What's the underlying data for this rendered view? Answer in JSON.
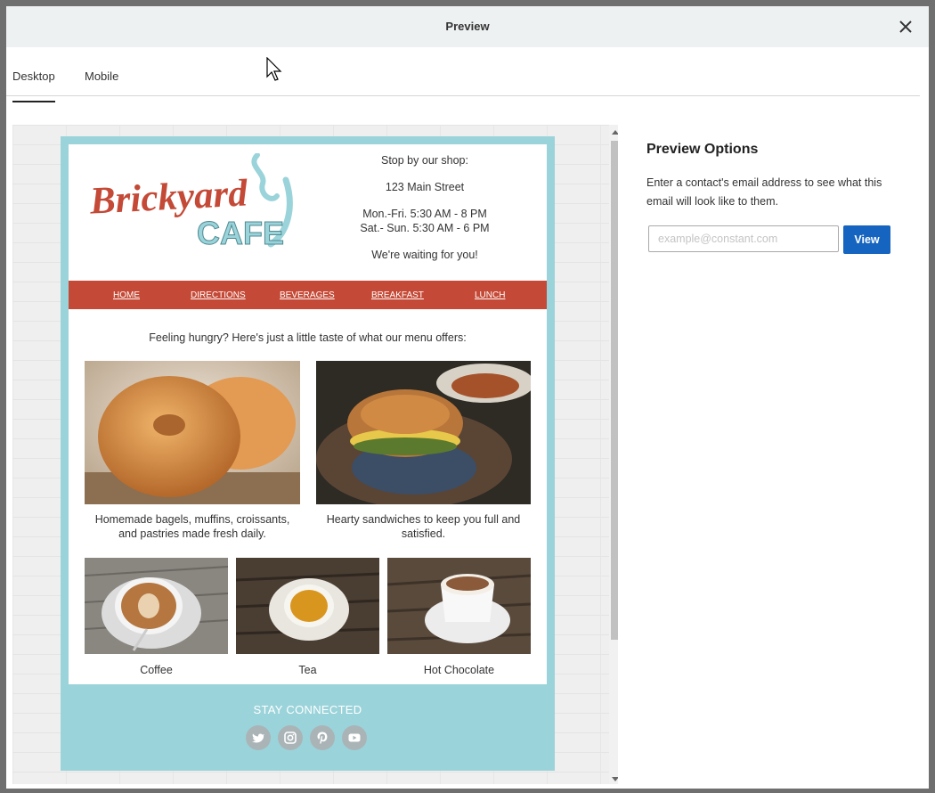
{
  "modal": {
    "title": "Preview"
  },
  "tabs": [
    {
      "label": "Desktop",
      "active": true
    },
    {
      "label": "Mobile",
      "active": false
    }
  ],
  "email": {
    "logo": {
      "line1": "Brickyard",
      "line2": "CAFE",
      "brand_red": "#c44936",
      "brand_teal": "#9bd3da"
    },
    "shop": {
      "heading": "Stop by our shop:",
      "address": "123 Main Street",
      "hours1": "Mon.-Fri. 5:30 AM - 8 PM",
      "hours2": "Sat.- Sun. 5:30 AM - 6 PM",
      "tagline": "We're waiting for you!"
    },
    "nav": [
      "HOME",
      "DIRECTIONS",
      "BEVERAGES",
      "BREAKFAST",
      "LUNCH"
    ],
    "intro": "Feeling hungry? Here's just a little taste of what our menu offers:",
    "features": [
      {
        "caption": "Homemade bagels, muffins, croissants, and pastries made fresh daily."
      },
      {
        "caption": "Hearty sandwiches to keep you full and satisfied."
      }
    ],
    "drinks": [
      {
        "caption": "Coffee"
      },
      {
        "caption": "Tea"
      },
      {
        "caption": "Hot Chocolate"
      }
    ],
    "stay_connected": "STAY CONNECTED",
    "social_icons": [
      "twitter-icon",
      "instagram-icon",
      "pinterest-icon",
      "youtube-icon"
    ]
  },
  "options": {
    "title": "Preview Options",
    "description": "Enter a contact's email address to see what this email will look like to them.",
    "email_placeholder": "example@constant.com",
    "view_label": "View"
  }
}
